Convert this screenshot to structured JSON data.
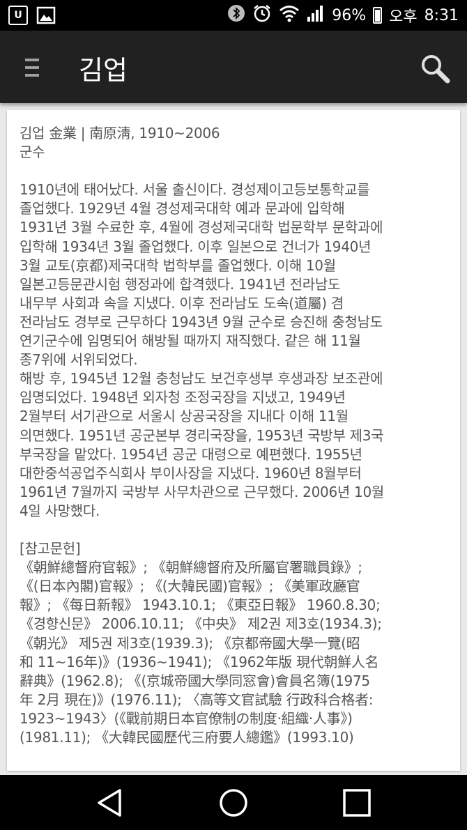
{
  "status_bar": {
    "battery": "96%",
    "ampm": "오후",
    "time": "8:31",
    "icons": [
      "u-plus-icon",
      "image-icon",
      "bluetooth-icon",
      "alarm-icon",
      "wifi-icon",
      "signal-icon",
      "battery-icon"
    ]
  },
  "app_bar": {
    "title": "김업",
    "menu_icon": "hamburger-menu-icon",
    "search_icon": "search-icon"
  },
  "article": {
    "lines": [
      "김업 金業 | 南原淸, 1910~2006",
      "군수",
      "",
      "1910년에 태어났다. 서울 출신이다. 경성제이고등보통학교를",
      "졸업했다. 1929년 4월 경성제국대학 예과 문과에 입학해",
      "1931년 3월 수료한 후, 4월에 경성제국대학 법문학부 문학과에",
      "입학해 1934년 3월 졸업했다. 이후 일본으로 건너가 1940년",
      "3월 교토(京都)제국대학 법학부를 졸업했다. 이해 10월",
      "일본고등문관시험 행정과에 합격했다. 1941년 전라남도",
      "내무부 사회과 속을 지냈다. 이후 전라남도 도속(道屬) 겸",
      "전라남도 경부로 근무하다 1943년 9월 군수로 승진해 충청남도",
      "연기군수에 임명되어 해방될 때까지 재직했다. 같은 해 11월",
      "종7위에 서위되었다.",
      "해방 후, 1945년 12월 충청남도 보건후생부 후생과장 보조관에",
      "임명되었다. 1948년 외자청 조정국장을 지냈고, 1949년",
      "2월부터 서기관으로 서울시 상공국장을 지내다 이해 11월",
      "의면했다. 1951년 공군본부 경리국장을, 1953년 국방부 제3국",
      "부국장을 맡았다. 1954년 공군 대령으로 예편했다. 1955년",
      "대한중석공업주식회사 부이사장을 지냈다. 1960년 8월부터",
      "1961년 7월까지 국방부 사무차관으로 근무했다. 2006년 10월",
      "4일 사망했다.",
      "",
      "[참고문헌]",
      "《朝鮮總督府官報》; 《朝鮮總督府及所屬官署職員錄》;",
      "《(日本內閣)官報》; 《(大韓民國)官報》; 《美軍政廳官",
      "報》; 《每日新報》 1943.10.1; 《東亞日報》 1960.8.30;",
      "《경향신문》 2006.10.11; 《中央》 제2권 제3호(1934.3);",
      "《朝光》 제5권 제3호(1939.3); 《京都帝國大學一覽(昭",
      "和 11~16年)》(1936~1941); 《1962年版 現代朝鮮人名",
      "辭典》(1962.8); 《(京城帝國大學同窓會)會員名簿(1975",
      "年 2月 現在)》(1976.11); 〈高等文官試驗 行政科合格者:",
      "1923~1943〉(《戰前期日本官僚制の制度·組織·人事》)",
      "(1981.11); 《大韓民國歷代三府要人總鑑》(1993.10)"
    ]
  },
  "nav_bar": {
    "buttons": [
      "back-icon",
      "home-icon",
      "recent-apps-icon"
    ]
  }
}
